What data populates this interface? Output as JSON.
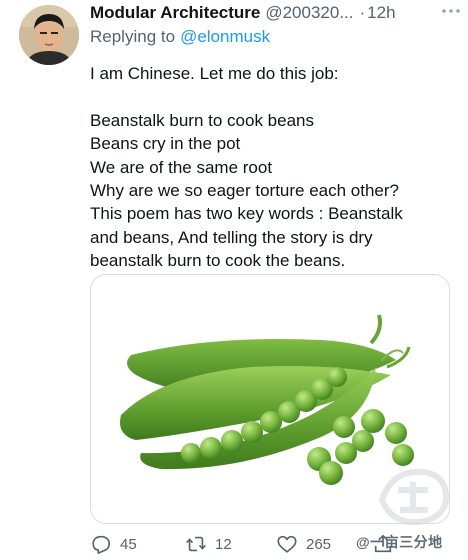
{
  "author": {
    "name": "Modular Architecture",
    "handle": "@200320...",
    "separator": "·",
    "time": "12h"
  },
  "reply": {
    "prefix": "Replying to",
    "mention": "@elonmusk"
  },
  "tweet": {
    "lines": [
      "I am Chinese. Let me do this job:",
      "",
      "Beanstalk burn to cook beans",
      "Beans cry in the pot",
      "We are of the same root",
      "Why are we so eager torture each other?",
      "This poem has two key words : Beanstalk",
      "and beans, And telling the story is dry",
      "beanstalk burn to cook the beans."
    ]
  },
  "actions": {
    "reply_count": "45",
    "retweet_count": "12",
    "like_count": "265"
  },
  "watermark": {
    "text": "@一亩三分地"
  },
  "icons": {
    "reply": "reply-icon",
    "retweet": "retweet-icon",
    "like": "heart-icon",
    "share": "share-icon",
    "more": "more-dots-icon"
  },
  "colors": {
    "text": "#0f1419",
    "secondary": "#536471",
    "link": "#1d9bf0",
    "pea_green": "#6fae3a"
  }
}
